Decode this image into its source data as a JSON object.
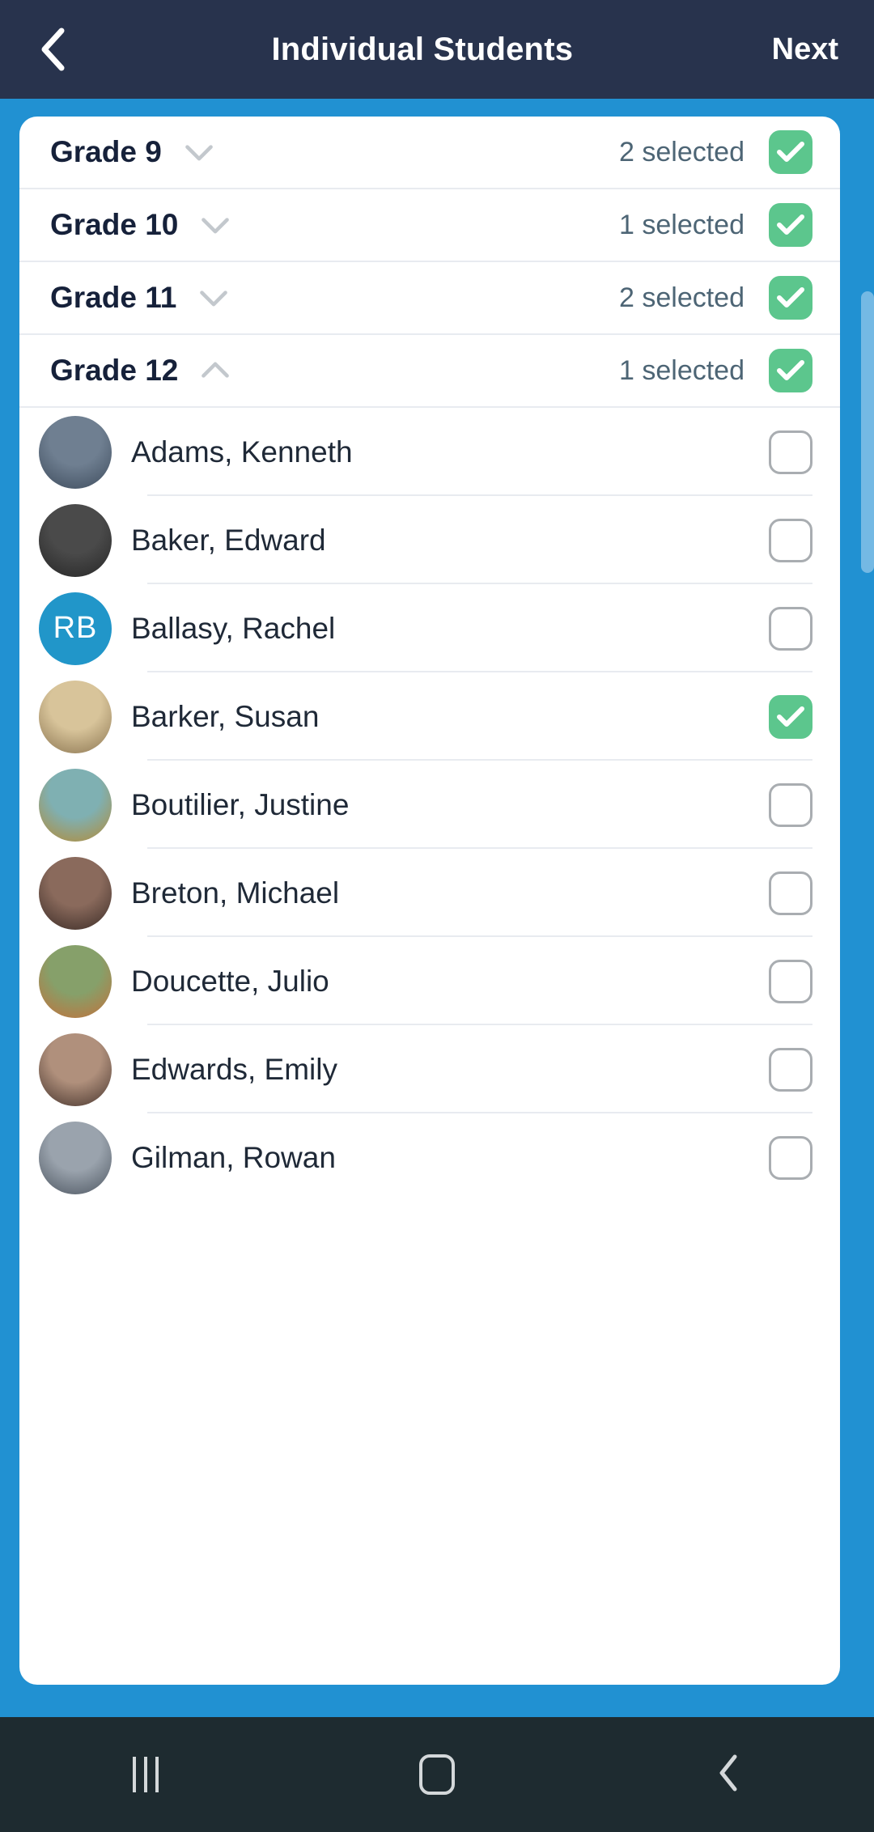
{
  "header": {
    "back_icon": "chevron-left-icon",
    "title": "Individual Students",
    "next_label": "Next"
  },
  "colors": {
    "header_bg": "#28334d",
    "page_bg": "#2191d2",
    "card_bg": "#ffffff",
    "checkbox_on": "#5cc68d",
    "checkbox_off_border": "#a9adb1",
    "initials_avatar_bg": "#2196c9",
    "scrollbar_thumb": "#74b9e4",
    "navbar_bg": "#1e2b30",
    "count_text": "#4d6575",
    "name_text": "#1f2937"
  },
  "grades": [
    {
      "label": "Grade 9",
      "count_text": "2 selected",
      "expanded": false,
      "chevron": "chevron-down-icon",
      "checked": true
    },
    {
      "label": "Grade 10",
      "count_text": "1 selected",
      "expanded": false,
      "chevron": "chevron-down-icon",
      "checked": true
    },
    {
      "label": "Grade 11",
      "count_text": "2 selected",
      "expanded": false,
      "chevron": "chevron-down-icon",
      "checked": true
    },
    {
      "label": "Grade 12",
      "count_text": "1 selected",
      "expanded": true,
      "chevron": "chevron-up-icon",
      "checked": true
    }
  ],
  "students": [
    {
      "name": "Adams, Kenneth",
      "avatar_type": "photo",
      "initials": "",
      "checked": false
    },
    {
      "name": "Baker, Edward",
      "avatar_type": "photo",
      "initials": "",
      "checked": false
    },
    {
      "name": "Ballasy, Rachel",
      "avatar_type": "initials",
      "initials": "RB",
      "checked": false
    },
    {
      "name": "Barker, Susan",
      "avatar_type": "photo",
      "initials": "",
      "checked": true
    },
    {
      "name": "Boutilier, Justine",
      "avatar_type": "photo",
      "initials": "",
      "checked": false
    },
    {
      "name": "Breton, Michael",
      "avatar_type": "photo",
      "initials": "",
      "checked": false
    },
    {
      "name": "Doucette, Julio",
      "avatar_type": "photo",
      "initials": "",
      "checked": false
    },
    {
      "name": "Edwards, Emily",
      "avatar_type": "photo",
      "initials": "",
      "checked": false
    },
    {
      "name": "Gilman, Rowan",
      "avatar_type": "photo",
      "initials": "",
      "checked": false
    }
  ],
  "navbar": {
    "recents_icon": "recents-icon",
    "home_icon": "home-icon",
    "back_icon": "back-icon"
  }
}
